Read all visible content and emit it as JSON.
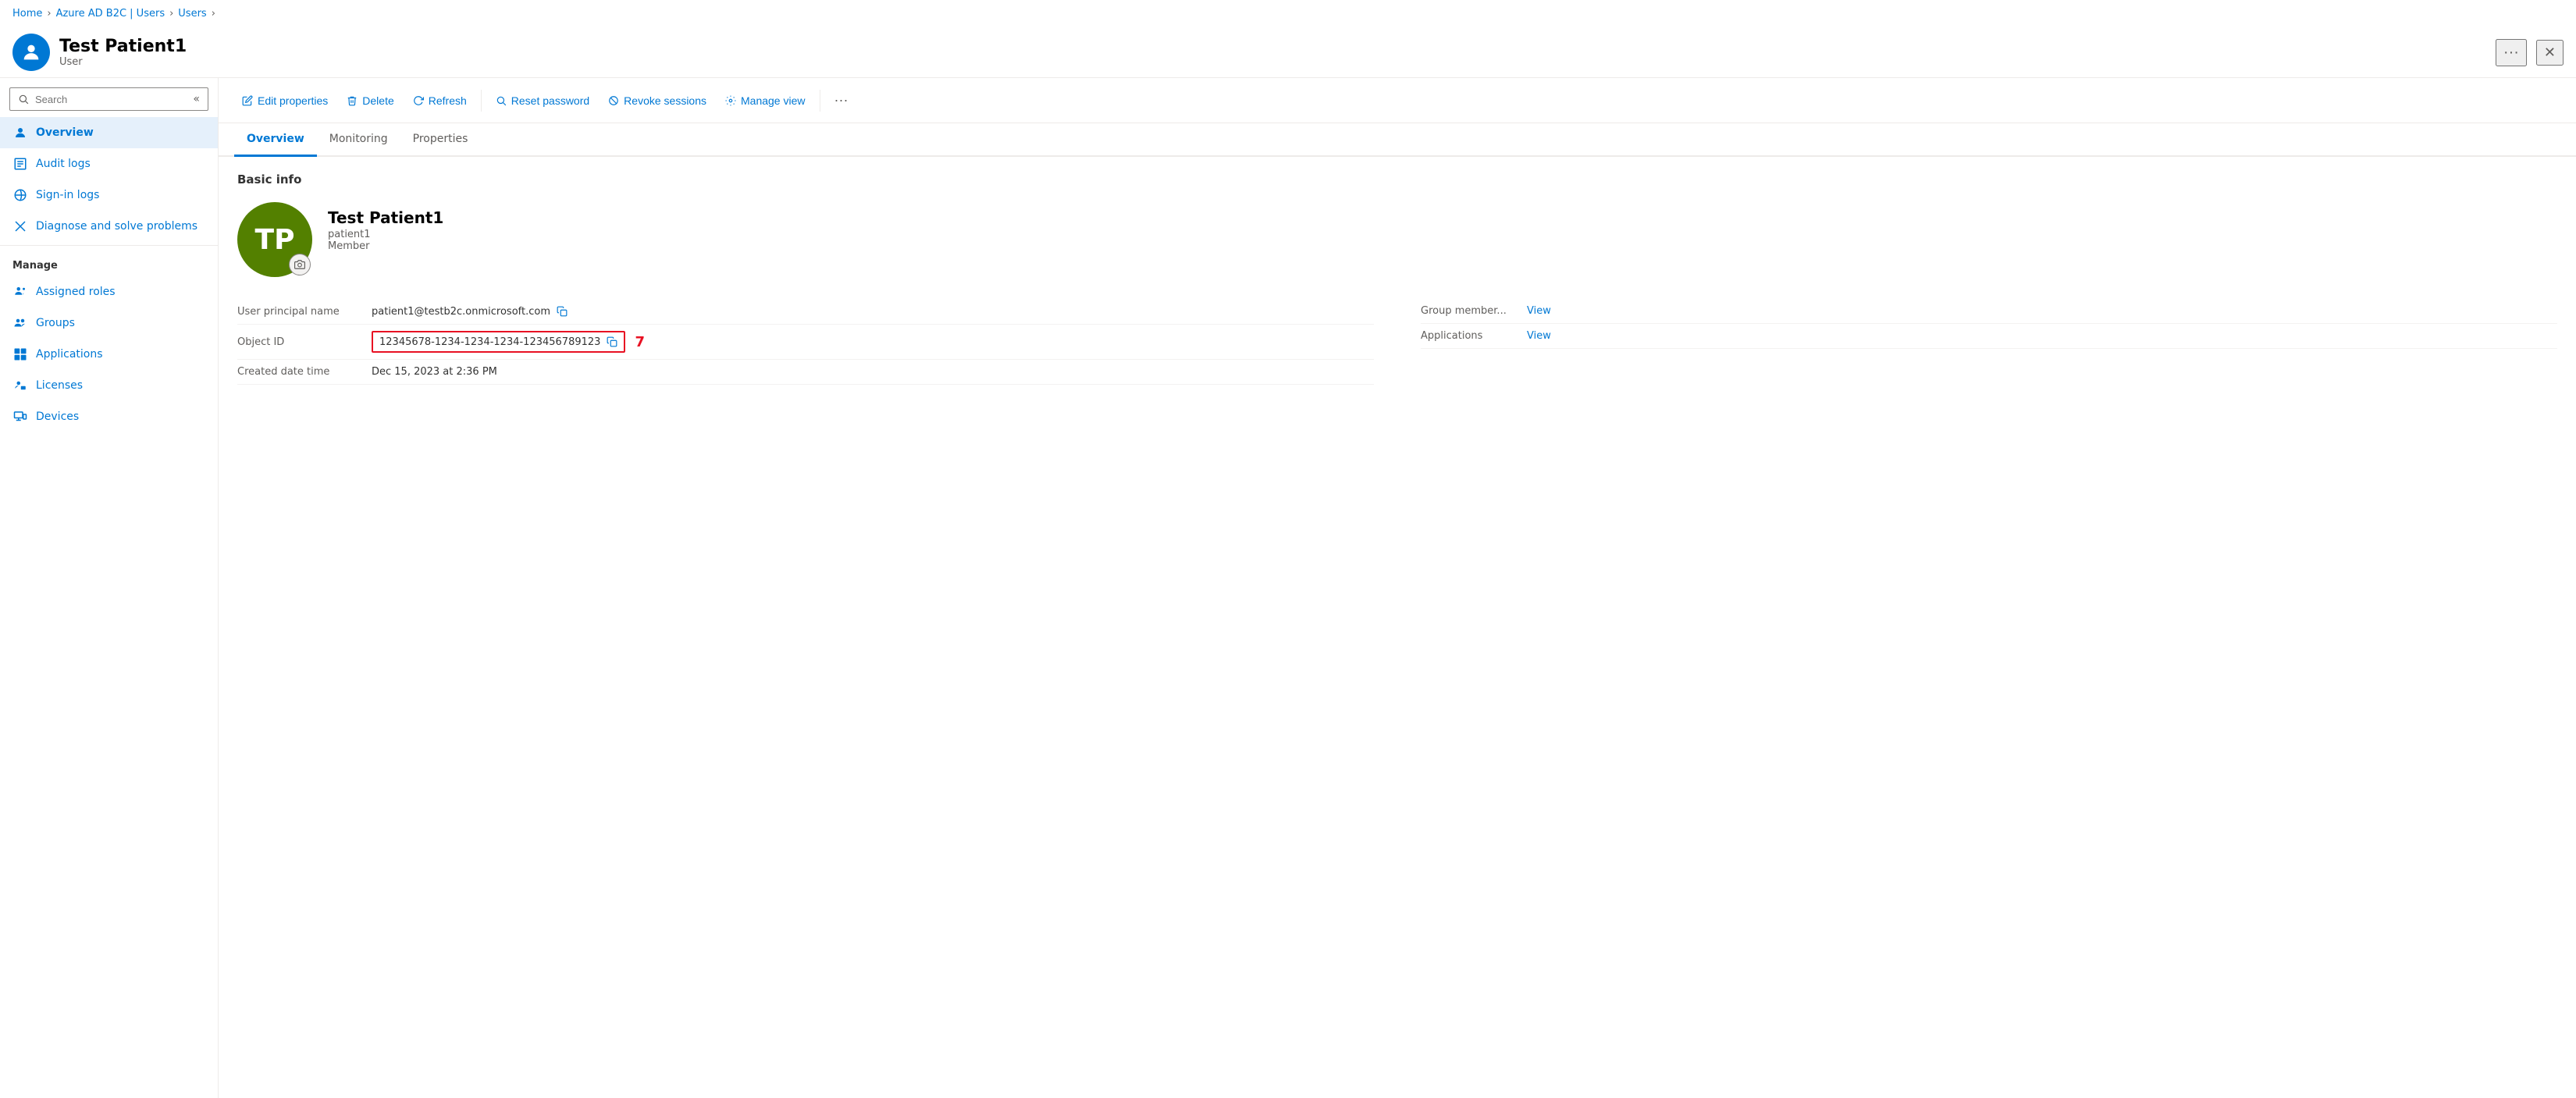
{
  "breadcrumb": {
    "items": [
      "Home",
      "Azure AD B2C | Users",
      "Users"
    ]
  },
  "header": {
    "title": "Test Patient1",
    "subtitle": "User",
    "more_label": "···",
    "close_label": "✕"
  },
  "sidebar": {
    "search_placeholder": "Search",
    "collapse_label": "«",
    "nav_items": [
      {
        "id": "overview",
        "label": "Overview",
        "icon": "user-icon",
        "active": true
      },
      {
        "id": "audit-logs",
        "label": "Audit logs",
        "icon": "audit-icon",
        "active": false
      },
      {
        "id": "sign-in-logs",
        "label": "Sign-in logs",
        "icon": "signin-icon",
        "active": false
      },
      {
        "id": "diagnose",
        "label": "Diagnose and solve problems",
        "icon": "diagnose-icon",
        "active": false
      }
    ],
    "manage_label": "Manage",
    "manage_items": [
      {
        "id": "assigned-roles",
        "label": "Assigned roles",
        "icon": "roles-icon"
      },
      {
        "id": "groups",
        "label": "Groups",
        "icon": "groups-icon"
      },
      {
        "id": "applications",
        "label": "Applications",
        "icon": "apps-icon"
      },
      {
        "id": "licenses",
        "label": "Licenses",
        "icon": "licenses-icon"
      },
      {
        "id": "devices",
        "label": "Devices",
        "icon": "devices-icon"
      }
    ]
  },
  "toolbar": {
    "edit_label": "Edit properties",
    "delete_label": "Delete",
    "refresh_label": "Refresh",
    "reset_password_label": "Reset password",
    "revoke_sessions_label": "Revoke sessions",
    "manage_view_label": "Manage view",
    "more_label": "···"
  },
  "tabs": {
    "items": [
      "Overview",
      "Monitoring",
      "Properties"
    ],
    "active": "Overview"
  },
  "overview": {
    "section_title": "Basic info",
    "avatar_initials": "TP",
    "user_name": "Test Patient1",
    "user_upn": "patient1",
    "user_role": "Member",
    "fields": [
      {
        "label": "User principal name",
        "value": "patient1@testb2c.onmicrosoft.com",
        "copyable": true,
        "highlight": false
      },
      {
        "label": "Object ID",
        "value": "12345678-1234-1234-1234-123456789123",
        "copyable": true,
        "highlight": true
      },
      {
        "label": "Created date time",
        "value": "Dec 15, 2023 at 2:36 PM",
        "copyable": false,
        "highlight": false
      }
    ],
    "number_badge": "7",
    "right_fields": [
      {
        "label": "Group member...",
        "link_label": "View"
      },
      {
        "label": "Applications",
        "link_label": "View"
      }
    ]
  }
}
